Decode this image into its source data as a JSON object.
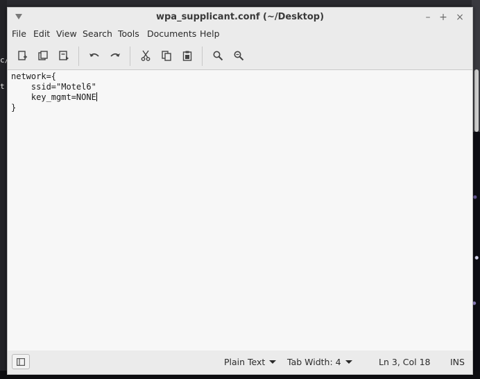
{
  "window": {
    "title": "wpa_supplicant.conf (~/Desktop)"
  },
  "background": {
    "left_text_1": "c/",
    "left_text_2": "t"
  },
  "menubar": {
    "items": [
      "File",
      "Edit",
      "View",
      "Search",
      "Tools",
      "Documents",
      "Help"
    ]
  },
  "toolbar": {
    "icons": [
      "new-document-icon",
      "open-document-icon",
      "save-document-icon",
      "undo-icon",
      "redo-icon",
      "cut-icon",
      "copy-icon",
      "paste-icon",
      "find-icon",
      "find-replace-icon"
    ]
  },
  "editor": {
    "lines": [
      "network={",
      "    ssid=\"Motel6\"",
      "    key_mgmt=NONE",
      "}"
    ],
    "cursor": {
      "line": 3,
      "col": 18
    }
  },
  "statusbar": {
    "syntax_label": "Plain Text",
    "tab_width_label": "Tab Width:",
    "tab_width_value": "4",
    "position_label": "Ln 3, Col 18",
    "insert_mode": "INS"
  },
  "colors": {
    "window_bg": "#ebebeb",
    "editor_bg": "#f7f7f7",
    "text": "#1a1a1a"
  }
}
